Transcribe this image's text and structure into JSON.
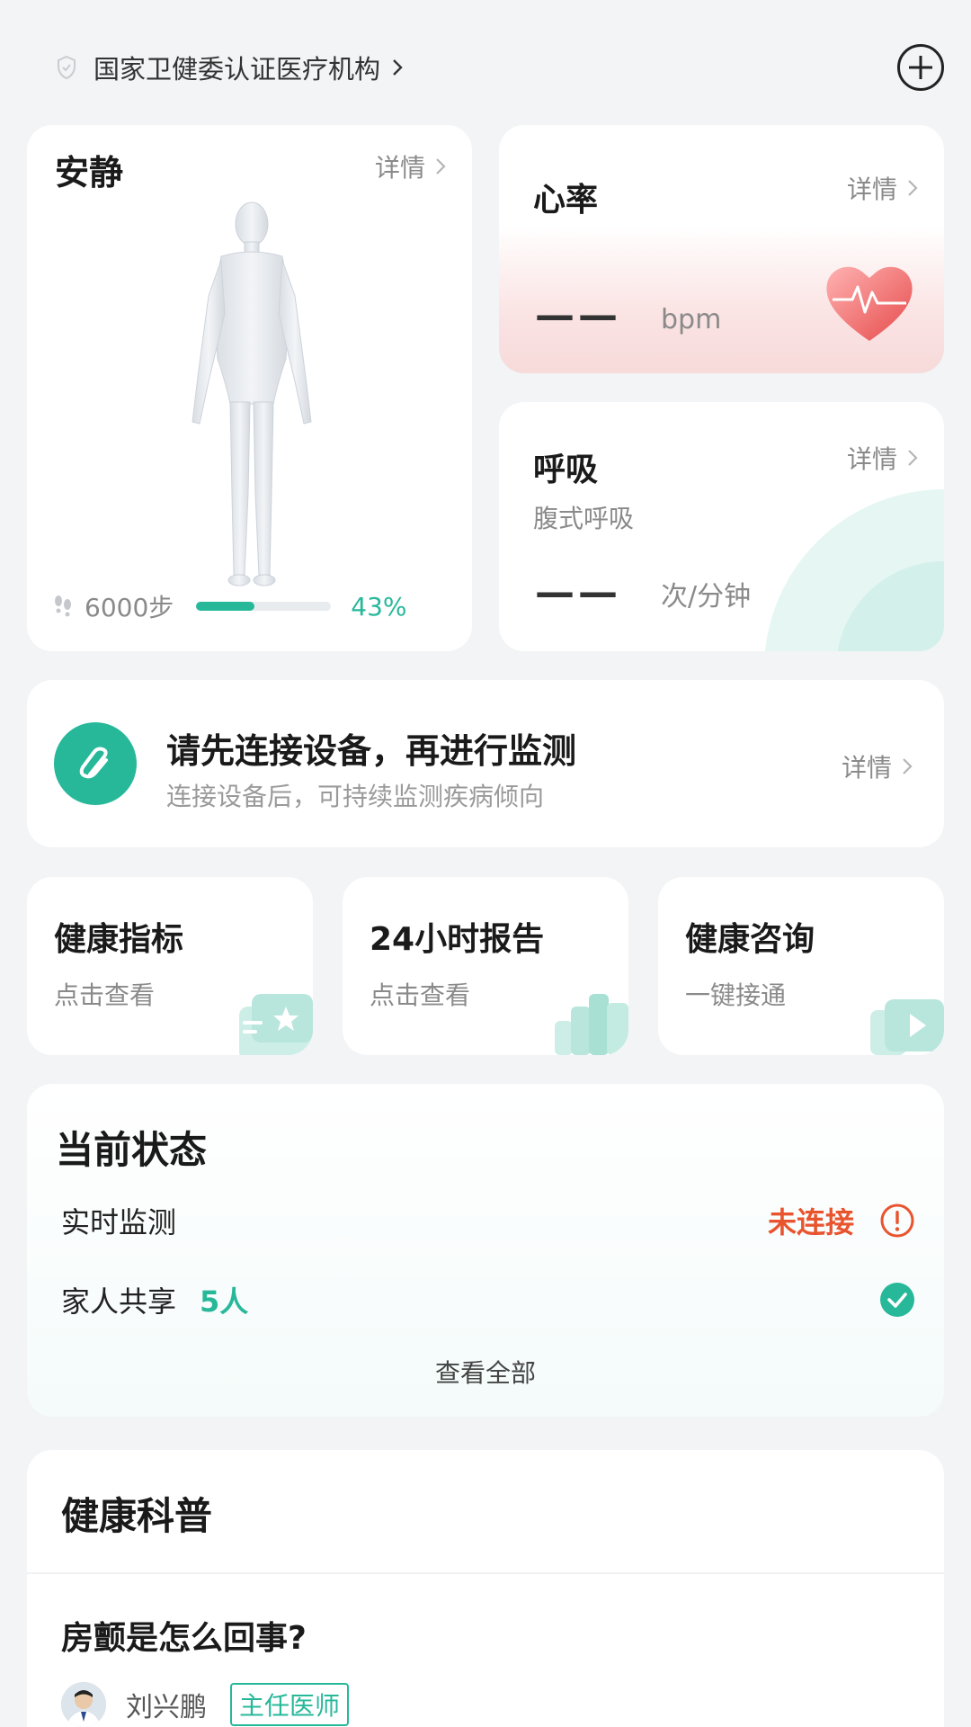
{
  "header": {
    "cert_text": "国家卫健委认证医疗机构"
  },
  "quiet_card": {
    "title": "安静",
    "detail": "详情",
    "steps": "6000步",
    "progress_percent": 43,
    "progress_label": "43%"
  },
  "heart_card": {
    "title": "心率",
    "detail": "详情",
    "value": "——",
    "unit": "bpm"
  },
  "breath_card": {
    "title": "呼吸",
    "detail": "详情",
    "subtitle": "腹式呼吸",
    "value": "——",
    "unit": "次/分钟"
  },
  "connect_banner": {
    "headline": "请先连接设备，再进行监测",
    "subtitle": "连接设备后，可持续监测疾病倾向",
    "detail": "详情"
  },
  "tiles": [
    {
      "title": "健康指标",
      "subtitle": "点击查看"
    },
    {
      "title": "24小时报告",
      "subtitle": "点击查看"
    },
    {
      "title": "健康咨询",
      "subtitle": "一键接通"
    }
  ],
  "status": {
    "heading": "当前状态",
    "realtime_label": "实时监测",
    "realtime_state": "未连接",
    "family_label": "家人共享",
    "family_count": "5人",
    "view_all": "查看全部"
  },
  "science": {
    "heading": "健康科普",
    "article_title": "房颤是怎么回事?",
    "author_name": "刘兴鹏",
    "author_title": "主任医师"
  },
  "colors": {
    "accent": "#27b89a",
    "warning": "#e8542e",
    "heart_tint": "#f7dada"
  }
}
